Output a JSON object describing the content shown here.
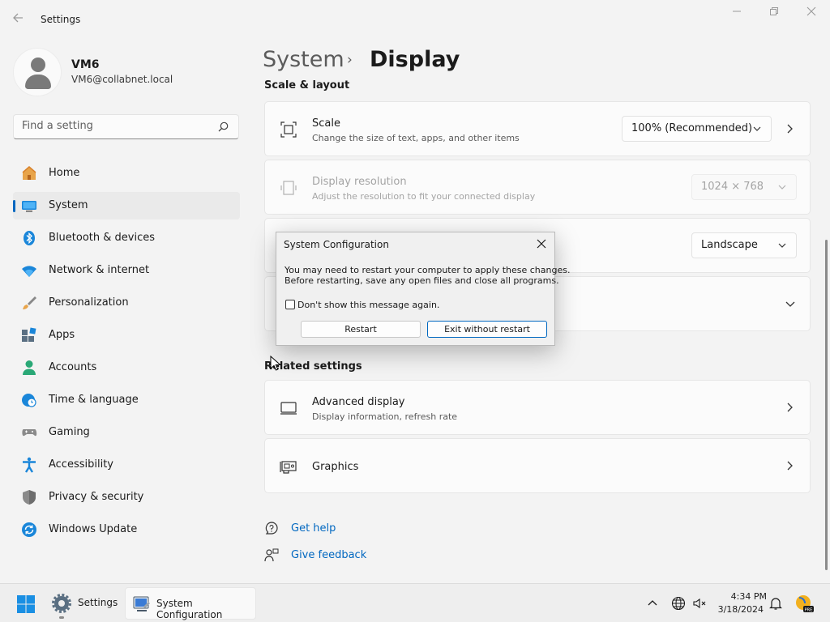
{
  "window": {
    "title": "Settings",
    "back_icon": "arrow-left-icon",
    "controls": [
      "minimize-icon",
      "restore-icon",
      "close-icon"
    ]
  },
  "profile": {
    "name": "VM6",
    "email": "VM6@collabnet.local",
    "avatar_icon": "person-icon"
  },
  "search": {
    "placeholder": "Find a setting",
    "icon": "search-icon"
  },
  "nav": {
    "selected": "System",
    "accent_color": "#0067c0",
    "items": [
      {
        "label": "Home",
        "icon": "home-icon"
      },
      {
        "label": "System",
        "icon": "monitor-icon"
      },
      {
        "label": "Bluetooth & devices",
        "icon": "bluetooth-icon"
      },
      {
        "label": "Network & internet",
        "icon": "wifi-icon"
      },
      {
        "label": "Personalization",
        "icon": "brush-icon"
      },
      {
        "label": "Apps",
        "icon": "apps-icon"
      },
      {
        "label": "Accounts",
        "icon": "person-icon"
      },
      {
        "label": "Time & language",
        "icon": "globe-clock-icon"
      },
      {
        "label": "Gaming",
        "icon": "gamepad-icon"
      },
      {
        "label": "Accessibility",
        "icon": "accessibility-icon"
      },
      {
        "label": "Privacy & security",
        "icon": "shield-icon"
      },
      {
        "label": "Windows Update",
        "icon": "update-icon"
      }
    ]
  },
  "main": {
    "breadcrumb": {
      "parent": "System",
      "separator": "›",
      "current": "Display"
    },
    "scale_layout_title": "Scale & layout",
    "cards": {
      "scale": {
        "title": "Scale",
        "subtitle": "Change the size of text, apps, and other items",
        "value": "100% (Recommended)",
        "icon": "scale-icon"
      },
      "resolution": {
        "title": "Display resolution",
        "subtitle": "Adjust the resolution to fit your connected display",
        "value": "1024 × 768",
        "icon": "resolution-icon",
        "disabled": true
      },
      "orientation": {
        "value": "Landscape"
      },
      "multiple": {
        "icon": "chevron-down-icon"
      }
    },
    "related_title": "Related settings",
    "related": [
      {
        "title": "Advanced display",
        "subtitle": "Display information, refresh rate",
        "icon": "monitor-outline-icon"
      },
      {
        "title": "Graphics",
        "subtitle": "",
        "icon": "graphics-card-icon"
      }
    ],
    "links": [
      {
        "label": "Get help",
        "icon": "help-icon"
      },
      {
        "label": "Give feedback",
        "icon": "feedback-icon"
      }
    ],
    "link_color": "#0067c0"
  },
  "dialog": {
    "title": "System Configuration",
    "message_line1": "You may need to restart your computer to apply these changes.",
    "message_line2": "Before restarting, save any open files and close all programs.",
    "checkbox_label": "Don't show this message again.",
    "checkbox_checked": false,
    "buttons": {
      "restart": "Restart",
      "exit": "Exit without restart"
    },
    "default_button": "exit"
  },
  "taskbar": {
    "apps": [
      {
        "label": "Settings",
        "icon": "gear-icon"
      },
      {
        "label": "System Configuration",
        "icon": "msconfig-icon"
      }
    ],
    "tray": [
      "chevron-up-icon",
      "globe-icon",
      "network-volume-icon"
    ],
    "time": "4:34 PM",
    "date": "3/18/2024",
    "extra_icons": [
      "notification-bell-icon",
      "copilot-pre-icon"
    ]
  }
}
